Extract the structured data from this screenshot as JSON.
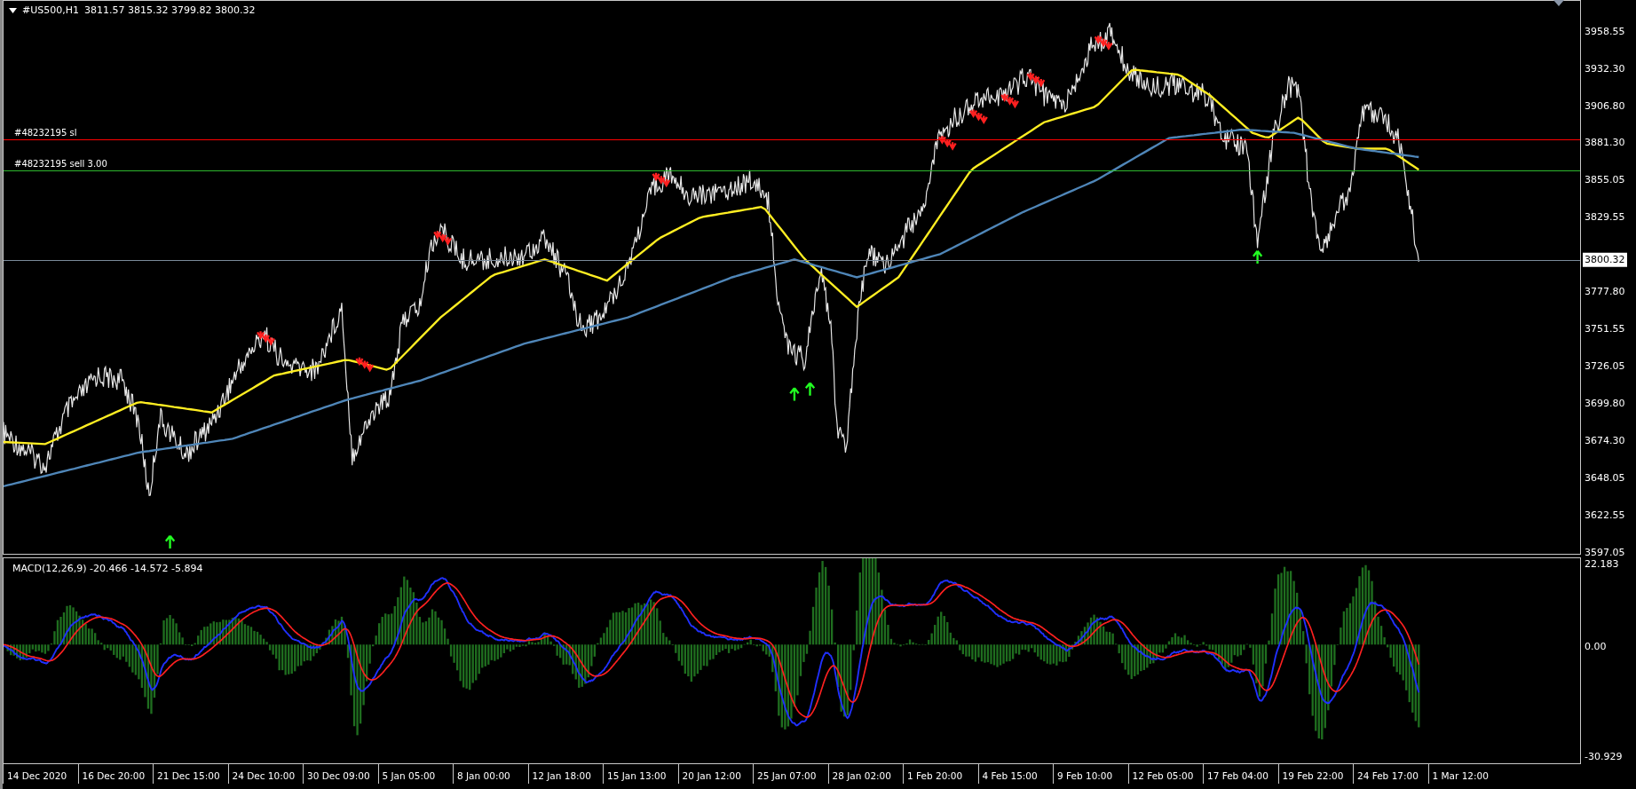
{
  "chart": {
    "symbol": "#US500,H1",
    "ohlc": "3811.57 3815.32 3799.82 3800.32",
    "order_lines": [
      {
        "label": "#48232195 sl",
        "kind": "stop_loss"
      },
      {
        "label": "#48232195 sell 3.00",
        "kind": "entry"
      }
    ],
    "current_price": {
      "label": "3800.32"
    },
    "price_axis": [
      "3958.55",
      "3932.30",
      "3906.80",
      "3881.30",
      "3855.05",
      "3829.55",
      "3777.80",
      "3751.55",
      "3726.05",
      "3699.80",
      "3674.30",
      "3648.05",
      "3622.55",
      "3597.05"
    ]
  },
  "macd": {
    "label": "MACD(12,26,9) -20.466 -14.572 -5.894",
    "axis": [
      "22.183",
      "0.00",
      "-30.929"
    ]
  },
  "time_axis": [
    "14 Dec 2020",
    "16 Dec 20:00",
    "21 Dec 15:00",
    "24 Dec 10:00",
    "30 Dec 09:00",
    "5 Jan 05:00",
    "8 Jan 00:00",
    "12 Jan 18:00",
    "15 Jan 13:00",
    "20 Jan 12:00",
    "25 Jan 07:00",
    "28 Jan 02:00",
    "1 Feb 20:00",
    "4 Feb 15:00",
    "9 Feb 10:00",
    "12 Feb 05:00",
    "17 Feb 04:00",
    "19 Feb 22:00",
    "24 Feb 17:00",
    "1 Mar 12:00"
  ]
}
